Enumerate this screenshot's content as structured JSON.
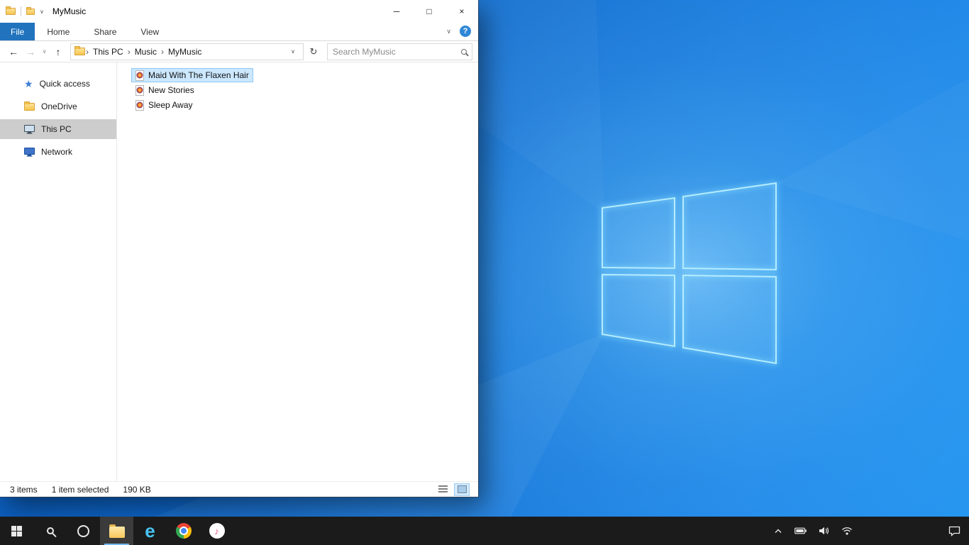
{
  "explorer": {
    "title": "MyMusic",
    "qat": {
      "dropdown_glyph": "∨"
    },
    "window_controls": {
      "minimize": "─",
      "maximize": "□",
      "close": "×"
    },
    "ribbon": {
      "tabs": [
        "File",
        "Home",
        "Share",
        "View"
      ],
      "collapse_glyph": "∨",
      "help_glyph": "?"
    },
    "nav": {
      "back_glyph": "←",
      "forward_glyph": "→",
      "history_glyph": "∨",
      "up_glyph": "↑",
      "breadcrumb": [
        "This PC",
        "Music",
        "MyMusic"
      ],
      "crumb_separator": "›",
      "address_dropdown_glyph": "∨",
      "refresh_glyph": "↻",
      "search_placeholder": "Search MyMusic"
    },
    "sidebar": {
      "items": [
        {
          "label": "Quick access",
          "icon": "star-icon"
        },
        {
          "label": "OneDrive",
          "icon": "onedrive-folder-icon"
        },
        {
          "label": "This PC",
          "icon": "computer-icon",
          "selected": true
        },
        {
          "label": "Network",
          "icon": "network-icon"
        }
      ]
    },
    "files": [
      {
        "name": "Maid With The Flaxen Hair",
        "icon": "media-file-icon",
        "selected": true
      },
      {
        "name": "New Stories",
        "icon": "media-file-icon",
        "selected": false
      },
      {
        "name": "Sleep Away",
        "icon": "media-file-icon",
        "selected": false
      }
    ],
    "status": {
      "count": "3 items",
      "selection": "1 item selected",
      "size": "190 KB"
    },
    "view_toggles": [
      "details-view",
      "thumbnails-view"
    ]
  },
  "taskbar": {
    "app_icons": [
      "start",
      "search",
      "cortana",
      "file-explorer",
      "internet-explorer",
      "chrome",
      "itunes"
    ],
    "active_app": "file-explorer",
    "tray_icons": [
      "hidden-icons-chevron",
      "battery",
      "volume",
      "network",
      "action-center"
    ],
    "itunes_glyph": "♪",
    "edge_glyph": "e"
  },
  "colors": {
    "accent": "#0078d7",
    "file_tab_bg": "#2173bd",
    "selection_bg": "#cce8ff",
    "selection_border": "#8fc7f5",
    "sidebar_selected_bg": "#cdcdcd",
    "taskbar_bg": "#1b1b1b",
    "wallpaper_base": "#1573d6"
  }
}
